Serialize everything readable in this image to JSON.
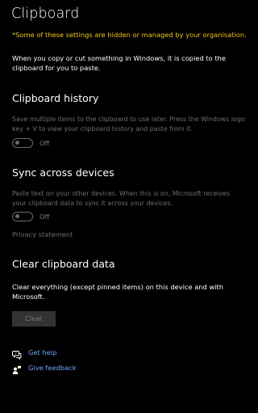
{
  "page": {
    "title": "Clipboard",
    "warning": "*Some of these settings are hidden or managed by your organisation.",
    "intro": "When you copy or cut something in Windows, it is copied to the clipboard for you to paste."
  },
  "clipboard_history": {
    "heading": "Clipboard history",
    "description": "Save multiple items to the clipboard to use later. Press the Windows logo key + V to view your clipboard history and paste from it.",
    "toggle_state": "Off"
  },
  "sync": {
    "heading": "Sync across devices",
    "description": "Paste text on your other devices. When this is on, Microsoft receives your clipboard data to sync it across your devices.",
    "toggle_state": "Off",
    "privacy_link": "Privacy statement"
  },
  "clear": {
    "heading": "Clear clipboard data",
    "description": "Clear everything (except pinned items) on this device and with Microsoft.",
    "button_label": "Clear"
  },
  "help": {
    "get_help": "Get help",
    "give_feedback": "Give feedback",
    "get_help_icon": "chat-help-icon",
    "give_feedback_icon": "feedback-person-icon"
  },
  "colors": {
    "background": "#000000",
    "warning": "#f0c419",
    "link": "#6fa8ff",
    "disabled_text": "#6e6e6e"
  }
}
